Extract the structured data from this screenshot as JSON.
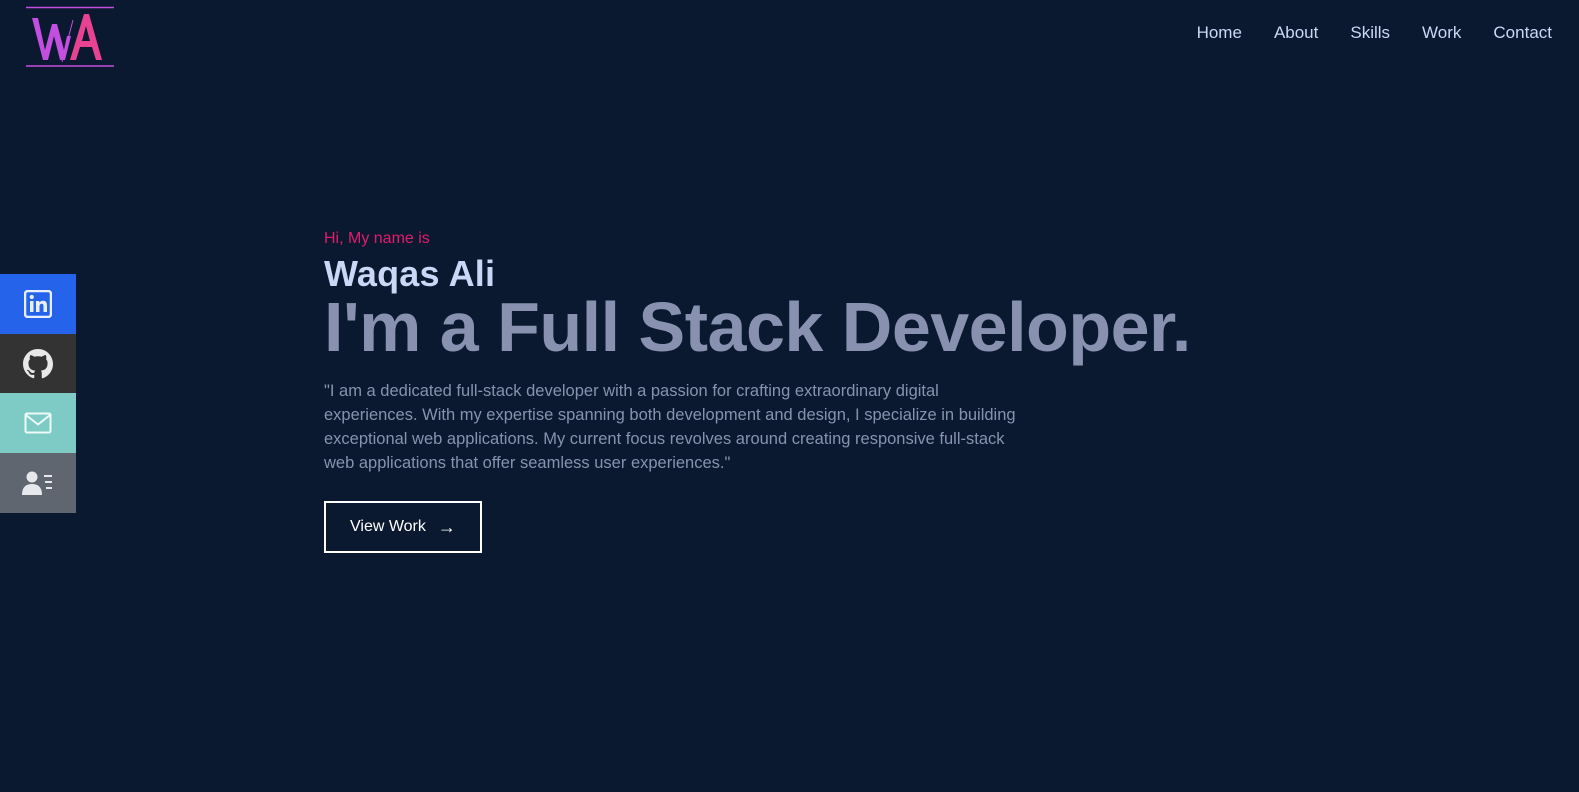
{
  "logo": {
    "letters": "WA",
    "colors": {
      "w": "#c44ee0",
      "a": "#e84393",
      "lines": "#c44ee0"
    }
  },
  "nav": {
    "items": [
      "Home",
      "About",
      "Skills",
      "Work",
      "Contact"
    ]
  },
  "social": {
    "items": [
      {
        "name": "linkedin",
        "icon": "linkedin-icon",
        "color": "#2563eb"
      },
      {
        "name": "github",
        "icon": "github-icon",
        "color": "#333333"
      },
      {
        "name": "email",
        "icon": "mail-icon",
        "color": "#7ecac4"
      },
      {
        "name": "resume",
        "icon": "contact-card-icon",
        "color": "#5f6670"
      }
    ]
  },
  "hero": {
    "intro": "Hi, My name is",
    "name": "Waqas Ali",
    "headline": "I'm a Full Stack Developer.",
    "description": "\"I am a dedicated full-stack developer with a passion for crafting extraordinary digital experiences. With my expertise spanning both development and design, I specialize in building exceptional web applications. My current focus revolves around creating responsive full-stack web applications that offer seamless user experiences.\"",
    "button_label": "View Work",
    "button_icon": "arrow-right-icon"
  },
  "colors": {
    "background": "#0a192f",
    "accent": "#e31b6d",
    "heading": "#ccd6f6",
    "muted": "#8892b0"
  }
}
